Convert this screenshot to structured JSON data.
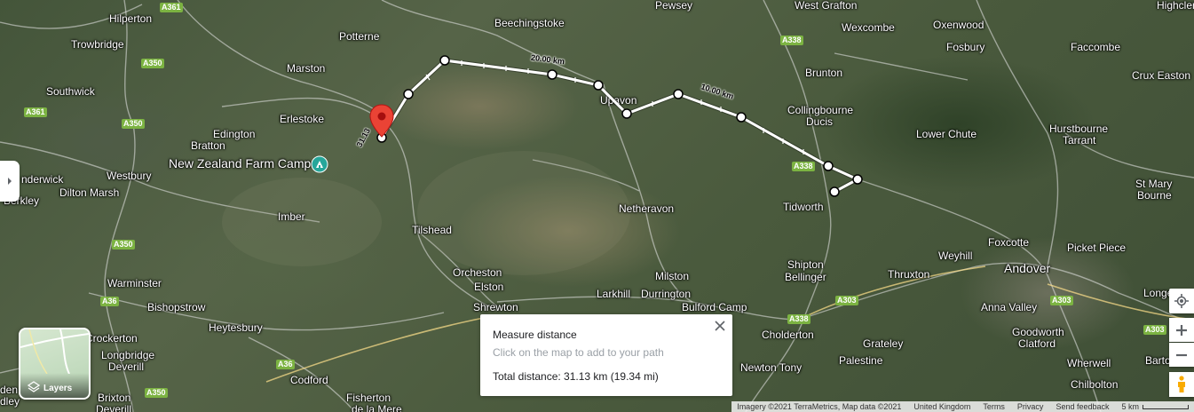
{
  "places": [
    {
      "name": "Hilperton"
    },
    {
      "name": "Trowbridge"
    },
    {
      "name": "Potterne"
    },
    {
      "name": "Beechingstoke"
    },
    {
      "name": "Pewsey"
    },
    {
      "name": "West Grafton"
    },
    {
      "name": "Wexcombe"
    },
    {
      "name": "Oxenwood"
    },
    {
      "name": "Highclere"
    },
    {
      "name": "Fosbury"
    },
    {
      "name": "Faccombe"
    },
    {
      "name": "Marston"
    },
    {
      "name": "Southwick"
    },
    {
      "name": "Brunton"
    },
    {
      "name": "Crux Easton"
    },
    {
      "name": "Erlestoke"
    },
    {
      "name": "Collingbourne"
    },
    {
      "name": "Ducis"
    },
    {
      "name": "Edington"
    },
    {
      "name": "Lower Chute"
    },
    {
      "name": "Hurstbourne"
    },
    {
      "name": "Tarrant"
    },
    {
      "name": "Bratton"
    },
    {
      "name": "New Zealand Farm Camp"
    },
    {
      "name": "Westbury"
    },
    {
      "name": "Upavon"
    },
    {
      "name": "St Mary"
    },
    {
      "name": "Bourne"
    },
    {
      "name": "Dilton Marsh"
    },
    {
      "name": "Tidworth"
    },
    {
      "name": "Imber"
    },
    {
      "name": "Netheravon"
    },
    {
      "name": "Tilshead"
    },
    {
      "name": "Foxcotte"
    },
    {
      "name": "Weyhill"
    },
    {
      "name": "Picket Piece"
    },
    {
      "name": "Andover"
    },
    {
      "name": "Orcheston"
    },
    {
      "name": "Shipton"
    },
    {
      "name": "Bellinger"
    },
    {
      "name": "Thruxton"
    },
    {
      "name": "Elston"
    },
    {
      "name": "Milston"
    },
    {
      "name": "Larkhill"
    },
    {
      "name": "Durrington"
    },
    {
      "name": "Warminster"
    },
    {
      "name": "Longe"
    },
    {
      "name": "Shrewton"
    },
    {
      "name": "Bulford Camp"
    },
    {
      "name": "Anna Valley"
    },
    {
      "name": "Bishopstrow"
    },
    {
      "name": "Heytesbury"
    },
    {
      "name": "Cholderton"
    },
    {
      "name": "Goodworth"
    },
    {
      "name": "Clatford"
    },
    {
      "name": "Crockerton"
    },
    {
      "name": "Longbridge"
    },
    {
      "name": "Deverill"
    },
    {
      "name": "Grateley"
    },
    {
      "name": "Newton Tony"
    },
    {
      "name": "Palestine"
    },
    {
      "name": "Wherwell"
    },
    {
      "name": "Barto"
    },
    {
      "name": "Codford"
    },
    {
      "name": "Brixton"
    },
    {
      "name": "Deverill"
    },
    {
      "name": "Fisherton"
    },
    {
      "name": "de la Mere"
    },
    {
      "name": "Chilbolton"
    },
    {
      "name": "nderwick"
    },
    {
      "name": "Berkley"
    },
    {
      "name": "dley"
    },
    {
      "name": "den"
    }
  ],
  "road_labels": [
    "A361",
    "A350",
    "A361",
    "A350",
    "A350",
    "A338",
    "A338",
    "A36",
    "A338",
    "A303",
    "A303",
    "A36",
    "A350",
    "A303"
  ],
  "measure_labels": [
    "20.00 km",
    "10.00 km",
    "31.13"
  ],
  "measure_panel": {
    "title": "Measure distance",
    "hint": "Click on the map to add to your path",
    "total": "Total distance: 31.13 km (19.34 mi)"
  },
  "layers_label": "Layers",
  "footer": {
    "imagery": "Imagery ©2021 TerraMetrics, Map data ©2021",
    "region": "United Kingdom",
    "terms": "Terms",
    "privacy": "Privacy",
    "feedback": "Send feedback",
    "scale": "5 km"
  },
  "colors": {
    "route": "#ffffff",
    "marker": "#ea4335",
    "road_badge": "#7cb342",
    "camp_icon": "#26a69a"
  }
}
